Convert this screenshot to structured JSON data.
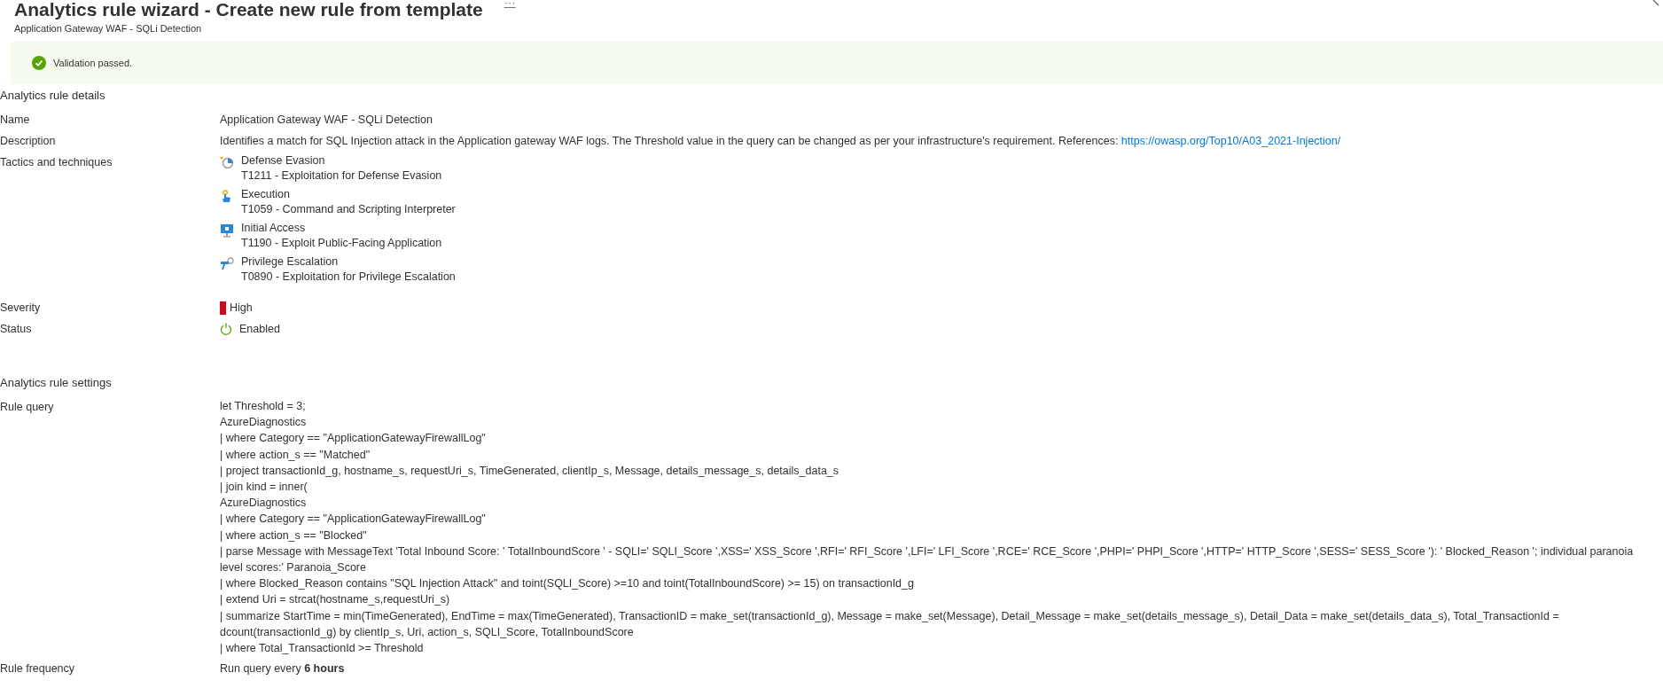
{
  "header": {
    "title": "Analytics rule wizard - Create new rule from template",
    "more": "···",
    "subtitle": "Application Gateway WAF - SQLi Detection"
  },
  "banner": {
    "kind": "success",
    "text": "Validation passed."
  },
  "details": {
    "heading": "Analytics rule details",
    "name": {
      "label": "Name",
      "value": "Application Gateway WAF - SQLi Detection"
    },
    "description": {
      "label": "Description",
      "value": "Identifies a match for SQL Injection attack in the Application gateway WAF logs. The Threshold value in the query can be changed as per your infrastructure's requirement. References:",
      "link": "https://owasp.org/Top10/A03_2021-Injection/"
    },
    "tactics": {
      "label": "Tactics and techniques",
      "items": [
        {
          "kind": "defense-evasion",
          "name": "Defense Evasion",
          "technique": "T1211 - Exploitation for Defense Evasion"
        },
        {
          "kind": "execution",
          "name": "Execution",
          "technique": "T1059 - Command and Scripting Interpreter"
        },
        {
          "kind": "initial-access",
          "name": "Initial Access",
          "technique": "T1190 - Exploit Public-Facing Application"
        },
        {
          "kind": "privilege-escalation",
          "name": "Privilege Escalation",
          "technique": "T0890 - Exploitation for Privilege Escalation"
        }
      ]
    },
    "severity": {
      "label": "Severity",
      "value": "High",
      "color": "#c50f1f"
    },
    "status": {
      "label": "Status",
      "value": "Enabled",
      "enabled": true
    }
  },
  "settings": {
    "heading": "Analytics rule settings",
    "query": {
      "label": "Rule query",
      "lines": [
        "let Threshold = 3;",
        "AzureDiagnostics",
        "| where Category == \"ApplicationGatewayFirewallLog\"",
        "| where action_s == \"Matched\"",
        "| project transactionId_g, hostname_s, requestUri_s, TimeGenerated, clientIp_s, Message, details_message_s, details_data_s",
        "| join kind = inner(",
        "AzureDiagnostics",
        "| where Category == \"ApplicationGatewayFirewallLog\"",
        "| where action_s == \"Blocked\"",
        "| parse Message with MessageText 'Total Inbound Score: ' TotalInboundScore ' - SQLI=' SQLI_Score ',XSS=' XSS_Score ',RFI=' RFI_Score ',LFI=' LFI_Score ',RCE=' RCE_Score ',PHPI=' PHPI_Score ',HTTP=' HTTP_Score ',SESS=' SESS_Score '): ' Blocked_Reason '; individual paranoia level scores:' Paranoia_Score",
        "| where Blocked_Reason contains \"SQL Injection Attack\" and toint(SQLI_Score) >=10 and toint(TotalInboundScore) >= 15) on transactionId_g",
        "| extend Uri = strcat(hostname_s,requestUri_s)",
        "| summarize StartTime = min(TimeGenerated), EndTime = max(TimeGenerated), TransactionID = make_set(transactionId_g), Message = make_set(Message), Detail_Message = make_set(details_message_s), Detail_Data = make_set(details_data_s), Total_TransactionId = dcount(transactionId_g) by clientIp_s, Uri, action_s, SQLI_Score, TotalInboundScore",
        "| where Total_TransactionId >= Threshold"
      ]
    },
    "frequency": {
      "label": "Rule frequency",
      "value": "Run query every **6 hours**"
    }
  }
}
